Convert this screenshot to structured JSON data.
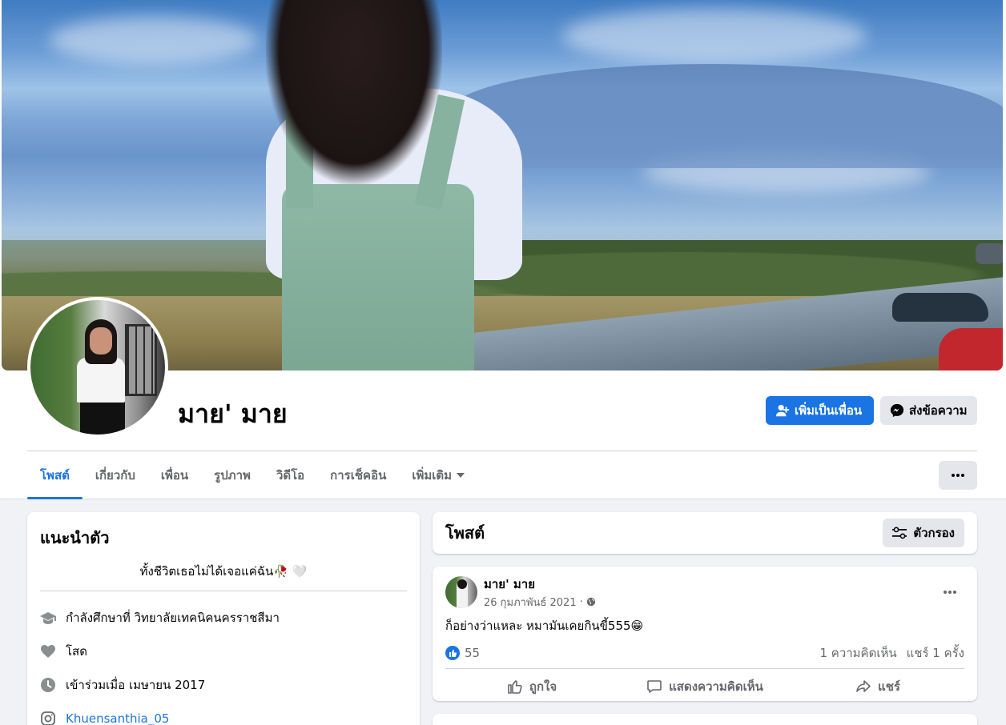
{
  "profile": {
    "name": "มาย' มาย",
    "add_friend_label": "เพิ่มเป็นเพื่อน",
    "message_label": "ส่งข้อความ"
  },
  "tabs": [
    {
      "label": "โพสต์",
      "active": true
    },
    {
      "label": "เกี่ยวกับ"
    },
    {
      "label": "เพื่อน"
    },
    {
      "label": "รูปภาพ"
    },
    {
      "label": "วิดีโอ"
    },
    {
      "label": "การเช็คอิน"
    },
    {
      "label": "เพิ่มเติม",
      "has_dropdown": true
    }
  ],
  "intro": {
    "title": "แนะนำตัว",
    "bio": "ทั้งชีวิตเธอไม่ได้เจอแค่ฉัน🥀 🤍",
    "rows": [
      {
        "icon": "graduation-cap-icon",
        "text": "กำลังศึกษาที่ วิทยาลัยเทคนิคนครราชสีมา"
      },
      {
        "icon": "heart-icon",
        "text": "โสด"
      },
      {
        "icon": "clock-icon",
        "text": "เข้าร่วมเมื่อ เมษายน 2017"
      },
      {
        "icon": "instagram-icon",
        "text": "Khuensanthia_05",
        "link": true
      }
    ]
  },
  "posts_section": {
    "title": "โพสต์",
    "filter_label": "ตัวกรอง"
  },
  "post": {
    "author": "มาย' มาย",
    "date": "26 กุมภาพันธ์ 2021",
    "dot": "·",
    "privacy_icon": "globe-icon",
    "text": "ก็อย่างว่าแหละ หมามันเคยกินขี้555😁",
    "like_count": "55",
    "comments": "1 ความคิดเห็น",
    "shares": "แชร์ 1 ครั้ง",
    "actions": {
      "like": "ถูกใจ",
      "comment": "แสดงความคิดเห็น",
      "share": "แชร์"
    }
  },
  "colors": {
    "accent": "#1b74e4",
    "page_bg": "#f0f2f5",
    "secondary_button": "#e4e6eb",
    "muted_text": "#65676b"
  }
}
